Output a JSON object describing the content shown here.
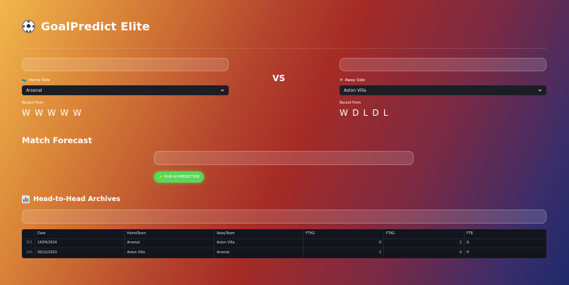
{
  "app": {
    "title": "GoalPredict Elite"
  },
  "match": {
    "home": {
      "label": "Home Side",
      "team": "Arsenal",
      "form_label": "Recent Form",
      "form": "W W W W W"
    },
    "vs": "VS",
    "away": {
      "label": "Away Side",
      "team": "Aston Villa",
      "form_label": "Recent Form",
      "form": "W D L D L"
    }
  },
  "forecast": {
    "title": "Match Forecast",
    "button_label": "RUN AI PREDICTION"
  },
  "h2h": {
    "title": "Head-to-Head Archives",
    "columns": [
      "",
      "Date",
      "HomeTeam",
      "AwayTeam",
      "FTHG",
      "FTAG",
      "FTR"
    ],
    "rows": [
      {
        "idx": "321",
        "date": "14/04/2024",
        "home": "Arsenal",
        "away": "Aston Villa",
        "fthg": "0",
        "ftag": "2",
        "ftr": "A"
      },
      {
        "idx": "155",
        "date": "09/12/2023",
        "home": "Aston Villa",
        "away": "Arsenal",
        "fthg": "1",
        "ftag": "0",
        "ftr": "H"
      }
    ]
  },
  "colors": {
    "accent_button": "#5cd65a",
    "select_bg": "#1c1e26",
    "table_bg": "#13151c"
  },
  "icons": {
    "title": "soccer-ball-icon",
    "home": "running-shoe-icon",
    "away": "airplane-icon",
    "h2h": "bar-chart-icon",
    "button": "sparkle-icon",
    "select": "chevron-down-icon"
  }
}
